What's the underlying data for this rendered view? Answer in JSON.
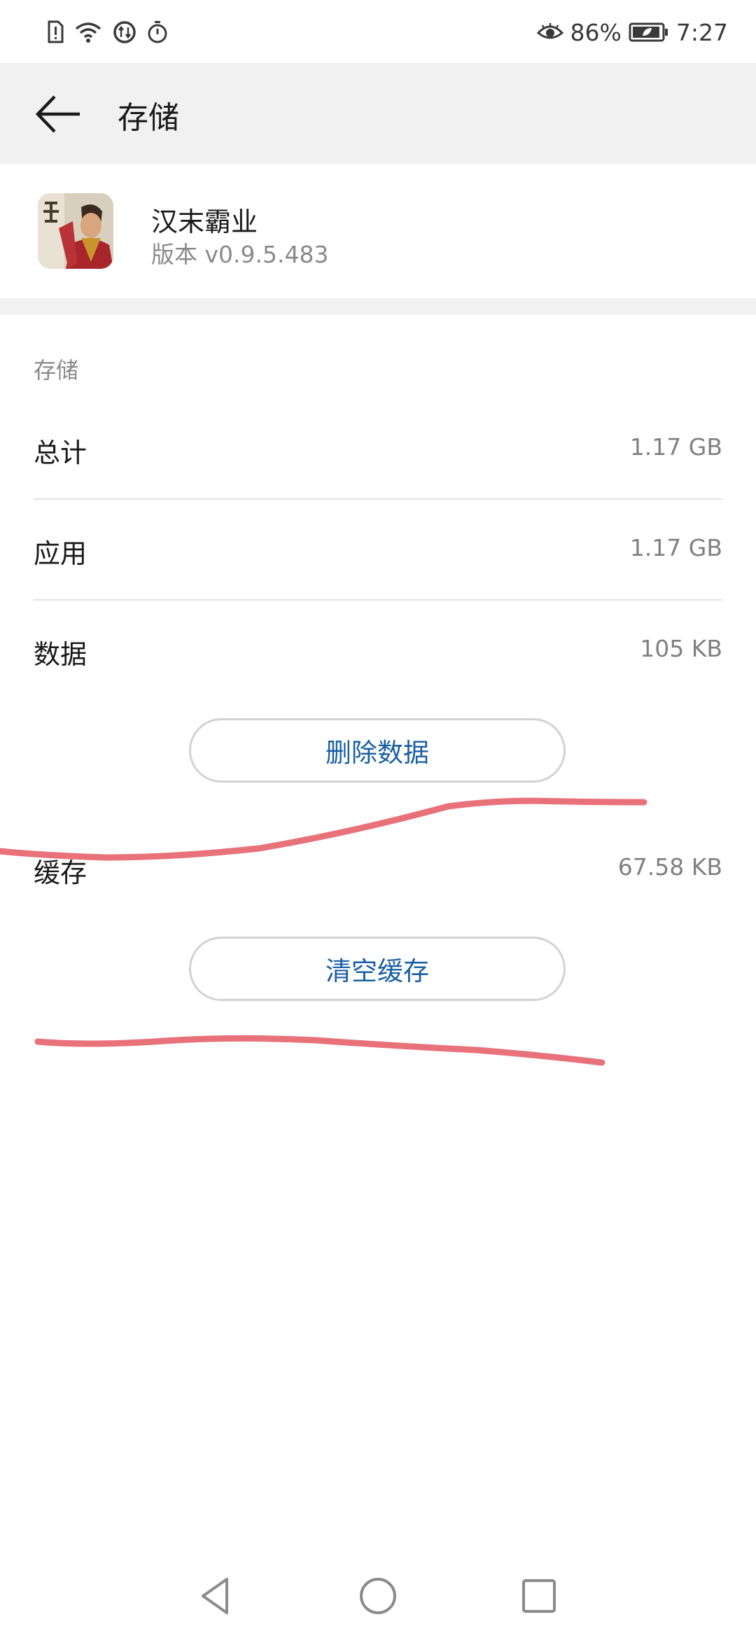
{
  "status_bar": {
    "battery_percent": "86%",
    "time": "7:27",
    "left_icons": [
      "sim-alert-icon",
      "wifi-icon",
      "data-saver-icon",
      "stopwatch-icon"
    ],
    "right_icons": [
      "eye-comfort-icon",
      "battery-icon"
    ]
  },
  "title_bar": {
    "title": "存储",
    "back_icon": "arrow-left-icon"
  },
  "app": {
    "name": "汉末霸业",
    "version": "版本 v0.9.5.483",
    "icon": "app-game-icon"
  },
  "storage": {
    "section_label": "存储",
    "rows": [
      {
        "label": "总计",
        "value": "1.17 GB"
      },
      {
        "label": "应用",
        "value": "1.17 GB"
      },
      {
        "label": "数据",
        "value": "105 KB"
      },
      {
        "label": "缓存",
        "value": "67.58 KB"
      }
    ],
    "delete_data_button": "删除数据",
    "clear_cache_button": "清空缓存"
  },
  "annotation": {
    "color": "#e8717a"
  },
  "nav_bar": {
    "icons": [
      "back-triangle-icon",
      "home-circle-icon",
      "recents-square-icon"
    ]
  }
}
